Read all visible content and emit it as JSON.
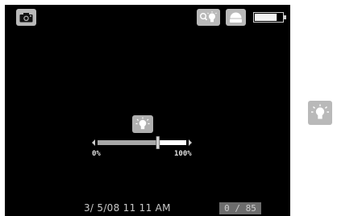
{
  "top_bar": {
    "camera_icon": "camera-icon",
    "zoom_light_icon": "zoom-light-icon",
    "dome_icon": "dome-light-icon",
    "battery_icon": "battery-icon",
    "battery_level": 0.8
  },
  "brightness": {
    "icon": "light-bulb-icon",
    "min_label": "0%",
    "max_label": "100%",
    "value": 0.68
  },
  "status": {
    "datetime": "3/ 5/08 11 11 AM",
    "counter": "0 / 85"
  },
  "side_panel": {
    "icon": "light-bulb-icon"
  },
  "colors": {
    "screen_bg": "#000000",
    "button_bg": "#b9b9b9",
    "counter_bg": "#6d6d6d",
    "text": "#c9c9c9"
  }
}
